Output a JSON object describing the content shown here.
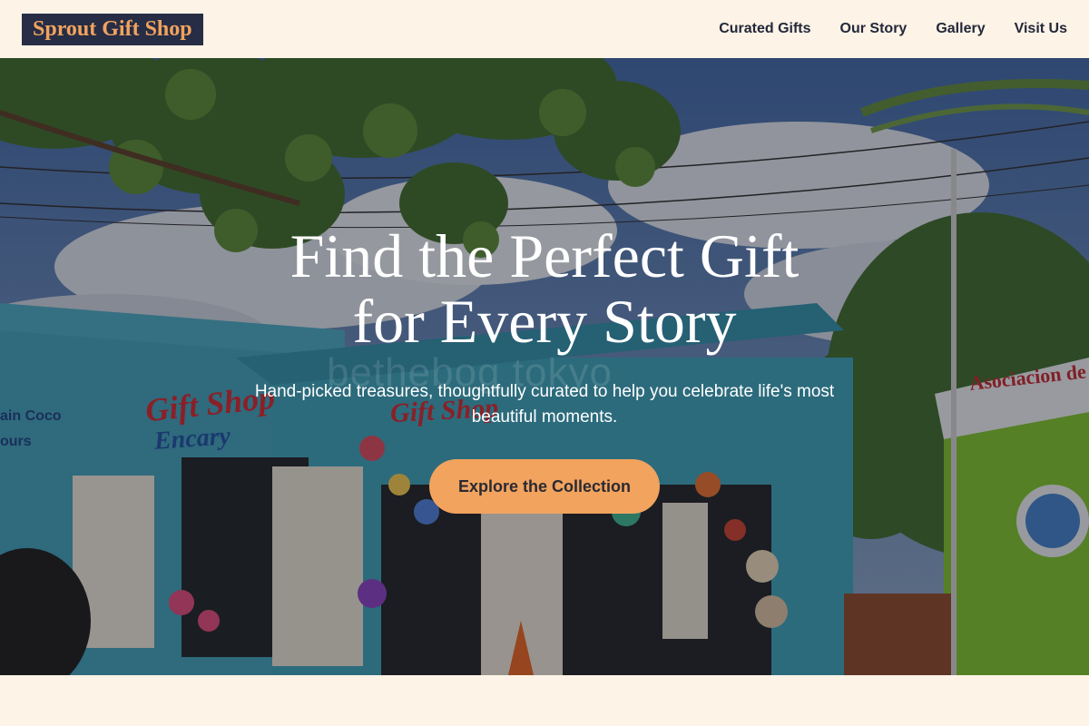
{
  "brand": {
    "name": "Sprout Gift Shop"
  },
  "nav": {
    "items": [
      "Curated Gifts",
      "Our Story",
      "Gallery",
      "Visit Us"
    ]
  },
  "hero": {
    "headline_line1": "Find the Perfect Gift",
    "headline_line2": "for Every Story",
    "subtitle": "Hand-picked treasures, thoughtfully curated to help you celebrate life's most beautiful moments.",
    "cta_label": "Explore the Collection",
    "watermark": "bethebog tokyo",
    "sign_left": "Gift Shop",
    "sign_left_sub": "Encary",
    "sign_mid": "Gift Shop",
    "sign_right": "Asociacion de tr",
    "side_sign": "ain Coco",
    "side_sign_sub": "ours"
  },
  "colors": {
    "accent": "#f2a35e",
    "navy": "#262d45",
    "background": "#fdf3e6"
  }
}
